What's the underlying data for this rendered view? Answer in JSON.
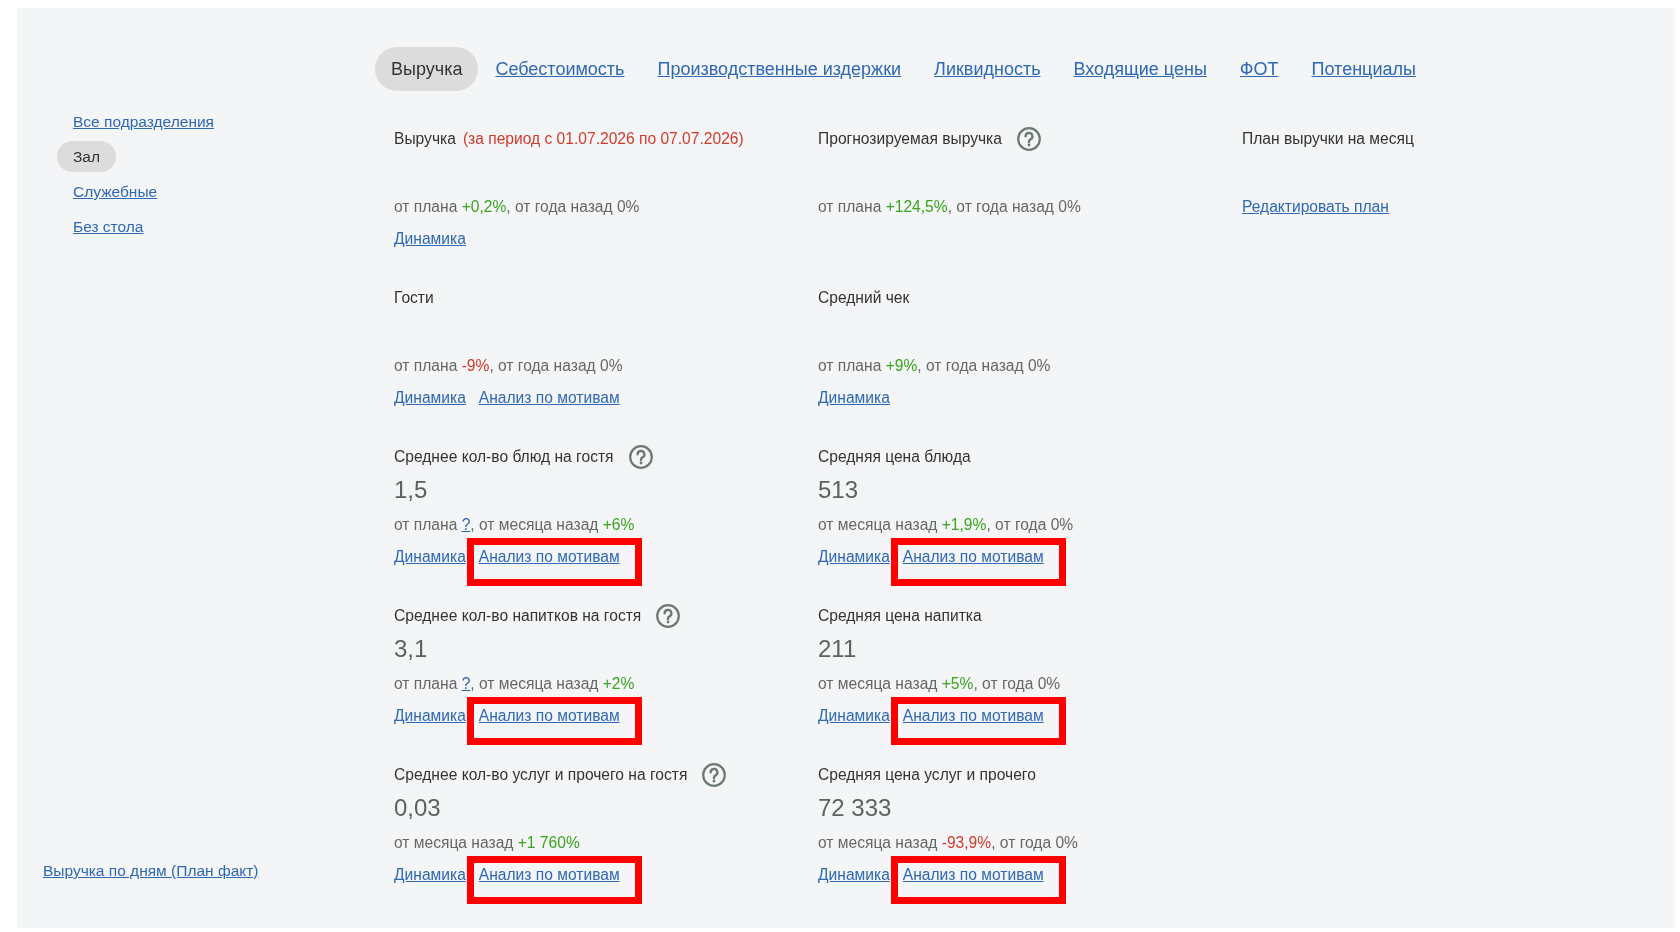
{
  "tabs": [
    {
      "label": "Выручка",
      "selected": true
    },
    {
      "label": "Себестоимость",
      "selected": false
    },
    {
      "label": "Производственные издержки",
      "selected": false
    },
    {
      "label": "Ликвидность",
      "selected": false
    },
    {
      "label": "Входящие цены",
      "selected": false
    },
    {
      "label": "ФОТ",
      "selected": false
    },
    {
      "label": "Потенциалы",
      "selected": false
    }
  ],
  "sidebar": {
    "items": [
      {
        "label": "Все подразделения",
        "selected": false
      },
      {
        "label": "Зал",
        "selected": true
      },
      {
        "label": "Служебные",
        "selected": false
      },
      {
        "label": "Без стола",
        "selected": false
      }
    ],
    "footer_link": "Выручка по дням (План факт)"
  },
  "metrics": {
    "rows": [
      {
        "cards": [
          {
            "title": "Выручка",
            "note": "(за период с 01.07.2026 по 07.07.2026)",
            "help": false,
            "comparison": [
              {
                "kind": "text",
                "text": "от плана "
              },
              {
                "kind": "up",
                "text": "+0,2%"
              },
              {
                "kind": "text",
                "text": ", от года назад 0%"
              }
            ],
            "links": [
              {
                "label": "Динамика",
                "highlighted": false
              }
            ]
          },
          {
            "title": "Прогнозируемая выручка",
            "help": true,
            "comparison": [
              {
                "kind": "text",
                "text": "от плана "
              },
              {
                "kind": "up",
                "text": "+124,5%"
              },
              {
                "kind": "text",
                "text": ", от года назад 0%"
              }
            ]
          },
          {
            "title": "План выручки на месяц",
            "help": false,
            "comparison": [
              {
                "kind": "link",
                "text": "Редактировать план"
              }
            ]
          }
        ]
      },
      {
        "cards": [
          {
            "title": "Гости",
            "help": false,
            "comparison": [
              {
                "kind": "text",
                "text": "от плана "
              },
              {
                "kind": "down",
                "text": "-9%"
              },
              {
                "kind": "text",
                "text": ", от года назад 0%"
              }
            ],
            "links": [
              {
                "label": "Динамика",
                "highlighted": false
              },
              {
                "label": "Анализ по мотивам",
                "highlighted": false
              }
            ]
          },
          {
            "title": "Средний чек",
            "help": false,
            "comparison": [
              {
                "kind": "text",
                "text": "от плана "
              },
              {
                "kind": "up",
                "text": "+9%"
              },
              {
                "kind": "text",
                "text": ", от года назад 0%"
              }
            ],
            "links": [
              {
                "label": "Динамика",
                "highlighted": false
              }
            ]
          }
        ]
      },
      {
        "cards": [
          {
            "title": "Среднее кол-во блюд на гостя",
            "help": true,
            "value": "1,5",
            "comparison": [
              {
                "kind": "text",
                "text": "от плана "
              },
              {
                "kind": "link",
                "text": "?"
              },
              {
                "kind": "text",
                "text": ", от месяца назад "
              },
              {
                "kind": "up",
                "text": "+6%"
              }
            ],
            "links": [
              {
                "label": "Динамика",
                "highlighted": false
              },
              {
                "label": "Анализ по мотивам",
                "highlighted": true
              }
            ]
          },
          {
            "title": "Средняя цена блюда",
            "help": false,
            "value": "513",
            "comparison": [
              {
                "kind": "text",
                "text": "от месяца назад "
              },
              {
                "kind": "up",
                "text": "+1,9%"
              },
              {
                "kind": "text",
                "text": ", от года 0%"
              }
            ],
            "links": [
              {
                "label": "Динамика",
                "highlighted": false
              },
              {
                "label": "Анализ по мотивам",
                "highlighted": true
              }
            ]
          }
        ]
      },
      {
        "cards": [
          {
            "title": "Среднее кол-во напитков на гостя",
            "help": true,
            "value": "3,1",
            "comparison": [
              {
                "kind": "text",
                "text": "от плана "
              },
              {
                "kind": "link",
                "text": "?"
              },
              {
                "kind": "text",
                "text": ", от месяца назад "
              },
              {
                "kind": "up",
                "text": "+2%"
              }
            ],
            "links": [
              {
                "label": "Динамика",
                "highlighted": false
              },
              {
                "label": "Анализ по мотивам",
                "highlighted": true
              }
            ]
          },
          {
            "title": "Средняя цена напитка",
            "help": false,
            "value": "211",
            "comparison": [
              {
                "kind": "text",
                "text": "от месяца назад "
              },
              {
                "kind": "up",
                "text": "+5%"
              },
              {
                "kind": "text",
                "text": ", от года 0%"
              }
            ],
            "links": [
              {
                "label": "Динамика",
                "highlighted": false
              },
              {
                "label": "Анализ по мотивам",
                "highlighted": true
              }
            ]
          }
        ]
      },
      {
        "cards": [
          {
            "title": "Среднее кол-во услуг и прочего на гостя",
            "help": true,
            "value": "0,03",
            "comparison": [
              {
                "kind": "text",
                "text": "от месяца назад "
              },
              {
                "kind": "up",
                "text": "+1 760%"
              }
            ],
            "links": [
              {
                "label": "Динамика",
                "highlighted": false
              },
              {
                "label": "Анализ по мотивам",
                "highlighted": true
              }
            ]
          },
          {
            "title": "Средняя цена услуг и прочего",
            "help": false,
            "value": "72 333",
            "comparison": [
              {
                "kind": "text",
                "text": "от месяца назад "
              },
              {
                "kind": "down",
                "text": "-93,9%"
              },
              {
                "kind": "text",
                "text": ", от года 0%"
              }
            ],
            "links": [
              {
                "label": "Динамика",
                "highlighted": false
              },
              {
                "label": "Анализ по мотивам",
                "highlighted": true
              }
            ]
          }
        ]
      }
    ]
  }
}
